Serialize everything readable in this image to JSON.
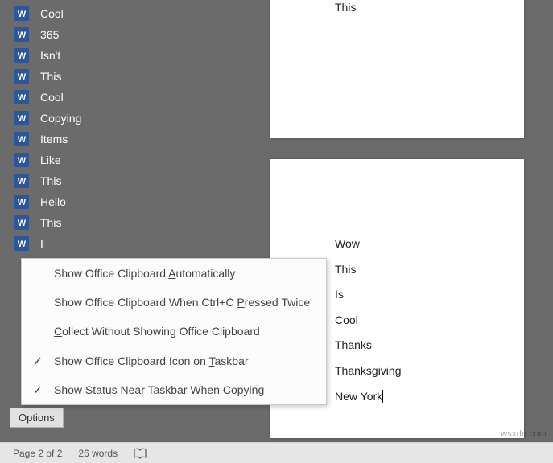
{
  "clipboard": {
    "items": [
      {
        "text": "Cool"
      },
      {
        "text": "365"
      },
      {
        "text": "Isn't"
      },
      {
        "text": "This"
      },
      {
        "text": "Cool"
      },
      {
        "text": "Copying"
      },
      {
        "text": "Items"
      },
      {
        "text": "Like"
      },
      {
        "text": "This"
      },
      {
        "text": "Hello"
      },
      {
        "text": "This"
      },
      {
        "text": "I"
      }
    ],
    "options_button": "Options"
  },
  "options_menu": [
    {
      "checked": false,
      "pre": "Show Office Clipboard ",
      "u": "A",
      "post": "utomatically"
    },
    {
      "checked": false,
      "pre": "Show Office Clipboard When Ctrl+C ",
      "u": "P",
      "post": "ressed Twice"
    },
    {
      "checked": false,
      "pre": "",
      "u": "C",
      "post": "ollect Without Showing Office Clipboard"
    },
    {
      "checked": true,
      "pre": "Show Office Clipboard Icon on ",
      "u": "T",
      "post": "askbar"
    },
    {
      "checked": true,
      "pre": "Show ",
      "u": "S",
      "post": "tatus Near Taskbar When Copying"
    }
  ],
  "document": {
    "page1": [
      "This"
    ],
    "page2": [
      "Wow",
      "This",
      "Is",
      "Cool",
      "Thanks",
      "Thanksgiving",
      "New York"
    ]
  },
  "status": {
    "page": "Page 2 of 2",
    "words": "26 words"
  },
  "watermark": "wsxdn.com"
}
